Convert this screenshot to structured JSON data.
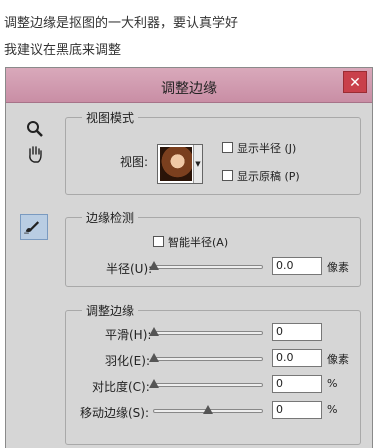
{
  "captions": [
    "调整边缘是抠图的一大利器，要认真学好",
    "我建议在黑底来调整"
  ],
  "dialog": {
    "title": "调整边缘",
    "close_symbol": "✕",
    "tools": [
      "zoom-icon",
      "hand-icon",
      "refine-brush-icon"
    ],
    "view_mode": {
      "legend": "视图模式",
      "view_label": "视图:",
      "show_radius": {
        "label": "显示半径 (J)",
        "checked": false
      },
      "show_original": {
        "label": "显示原稿 (P)",
        "checked": false
      }
    },
    "edge_detection": {
      "legend": "边缘检测",
      "smart_radius": {
        "label": "智能半径(A)",
        "checked": false
      },
      "radius": {
        "label": "半径(U):",
        "value": "0.0",
        "unit": "像素",
        "level": 0
      }
    },
    "adjust_edge": {
      "legend": "调整边缘",
      "smooth": {
        "label": "平滑(H):",
        "value": "0",
        "unit": "",
        "level": 0
      },
      "feather": {
        "label": "羽化(E):",
        "value": "0.0",
        "unit": "像素",
        "level": 0
      },
      "contrast": {
        "label": "对比度(C):",
        "value": "0",
        "unit": "%",
        "level": 0
      },
      "shift_edge": {
        "label": "移动边缘(S):",
        "value": "0",
        "unit": "%",
        "level": 0.5
      }
    }
  }
}
